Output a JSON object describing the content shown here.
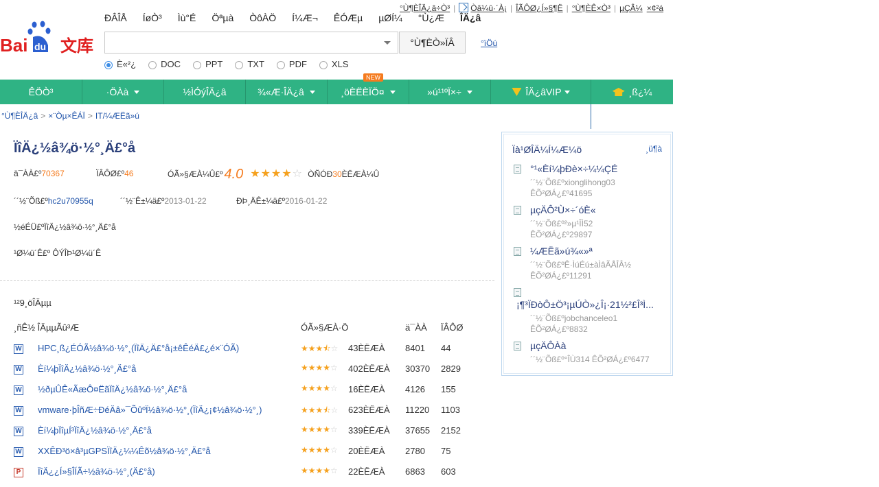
{
  "toplinks": [
    "°Ù¶ÈÎÄ¿â÷Ò³",
    "Òâ¼û·´À¡",
    "ÎÃÔØ¿Í»§¶Ë",
    "°Ù¶ÈÊ×Ò³",
    "µÇÂ¼",
    "×¢²á"
  ],
  "logo": {
    "text_a": "Bai",
    "text_b": "du",
    "text_c": "文库"
  },
  "topnav": [
    "ÐÂÎÅ",
    "ÍøÒ³",
    "Ìù°É",
    "Öªµà",
    "ÒôÀÖ",
    "Í¼Æ¬",
    "ÊÓÆµ",
    "µØÍ¼",
    "°Ù¿Æ",
    "ÎÄ¿â"
  ],
  "search": {
    "value": "",
    "button": "°Ù¶ÈÒ»ÏÂ",
    "help": "°ïÖú"
  },
  "filetypes": [
    {
      "label": "È«²¿",
      "checked": true
    },
    {
      "label": "DOC",
      "checked": false
    },
    {
      "label": "PPT",
      "checked": false
    },
    {
      "label": "TXT",
      "checked": false
    },
    {
      "label": "PDF",
      "checked": false
    },
    {
      "label": "XLS",
      "checked": false
    }
  ],
  "mainnav": {
    "items": [
      "ÊÖÒ³",
      "·ÖÀà",
      "½ÌÓýÎÄ¿â",
      "¾«Æ·ÎÄ¿â",
      "¸öÈËÈÏÖ¤",
      "»ú¹¹ºÏ×÷",
      "ÎÄ¿âVIP",
      "¸ß¿¼"
    ],
    "new_badge": "NEW"
  },
  "breadcrumb": [
    "°Ù¶ÈÎÄ¿â",
    "×¨Òµ×ÊÁÏ",
    "IT/¼ÆËã»ú"
  ],
  "doc": {
    "title": "ÏîÄ¿½â¾ö·½°¸Ä£°å",
    "views_label": "ä¯ÀÀ£º",
    "views": "70367",
    "downloads_label": "ÏÂÔØ£º",
    "downloads": "46",
    "rating_label": "ÓÃ»§ÆÀ¼Û£º",
    "score": "4.0",
    "stars": 4,
    "reviews_prefix": "ÒÑÓÐ",
    "reviews": "30",
    "reviews_suffix": "ÈËÆÀ¼Û",
    "uploader_label": "´´½¨Õß£º",
    "uploader": "hc2u70955q",
    "created_label": "´´½¨Ê±¼ä£º",
    "created": "2013-01-22",
    "updated_label": "ÐÞ¸ÄÊ±¼ä£º",
    "updated": "2016-01-22",
    "desc": "½éÉÜ£ºÏîÄ¿½â¾ö·½°¸Ä£°å",
    "tags": "¹Ø¼ü´Ê£º ÔÝÎÞ¹Ø¼ü´Ê"
  },
  "listing": {
    "total": "¹²9¸öÎÄµµ",
    "headers": [
      "¸ñÊ½ ÎÄµµÃû³Æ",
      "ÓÃ»§ÆÀ·Ö",
      "ä¯ÀÀ",
      "ÏÂÔØ"
    ],
    "rows": [
      {
        "type": "W",
        "title": "HPC¸ß¿ÉÓÃ½â¾ö·½°¸(ÏîÄ¿Ä£°å¡±êÊéÄ£¿é×¨ÓÃ)",
        "stars": 3.5,
        "count": "43ÈËÆÀ",
        "views": "8401",
        "downloads": "44"
      },
      {
        "type": "W",
        "title": "Èí¼þÏîÄ¿½â¾ö·½°¸Ä£°å",
        "stars": 4,
        "count": "402ÈËÆÀ",
        "views": "30370",
        "downloads": "2829"
      },
      {
        "type": "W",
        "title": "½ðµÛÊ«ÃæÔ¤ËãÏîÄ¿½â¾ö·½°¸Ä£°å",
        "stars": 4,
        "count": "16ÈËÆÀ",
        "views": "4126",
        "downloads": "155"
      },
      {
        "type": "W",
        "title": "vmware·þÎñÆ÷ÐéÄâ»¯ÕûºÏ½â¾ö·½°¸(ÏîÄ¿¡¢½â¾ö·½°¸)",
        "stars": 3.5,
        "count": "623ÈËÆÀ",
        "views": "11220",
        "downloads": "1103"
      },
      {
        "type": "W",
        "title": "Èí¼þÏîµÍ³ÏîÄ¿½â¾ö·½°¸Ä£°å",
        "stars": 4,
        "count": "339ÈËÆÀ",
        "views": "37655",
        "downloads": "2152"
      },
      {
        "type": "W",
        "title": "XXÊÐ³ö×â³µGPSÏîÄ¿¼¼Êõ½â¾ö·½°¸Ä£°å",
        "stars": 4,
        "count": "20ÈËÆÀ",
        "views": "2780",
        "downloads": "75"
      },
      {
        "type": "P",
        "title": "ÏîÄ¿¿Í»§ÎÍÃ÷½â¾ö·½°¸(Ä£°å)",
        "stars": 4,
        "count": "22ÈËÆÀ",
        "views": "6863",
        "downloads": "603"
      }
    ]
  },
  "sidebar": {
    "title": "Ïà¹ØÎÄ¼Í¼Æ¼ö",
    "more": "¸ü¶à",
    "items": [
      {
        "title": "°¹«Èí¼þÐè×÷¼¼ÇÉ",
        "author": "´´½¨Õß£ºxionglihong03",
        "downloads": "ÊÕ²ØÁ¿£º41695"
      },
      {
        "title": "µçÄÔ²Ù×÷´óÈ«",
        "author": "´´½¨Õß£º²»µ¹ÎÌ52",
        "downloads": "ÊÕ²ØÁ¿£º29897"
      },
      {
        "title": "¼ÆËã»ú¾«»ª",
        "author": "´´½¨Õß£ºÊ·ÌúÉú±àÌâÃÅÎÂ½",
        "downloads": "ÊÕ²ØÁ¿£º11291"
      },
      {
        "title": "¡¶³ÏÐòÔ±Ö³¡µÚÒ»¿Î¡·21½²£Î³Ì...",
        "author": "´´½¨Õß£ºjobchanceleo1",
        "downloads": "ÊÕ²ØÁ¿£º8832"
      },
      {
        "title": "µçÄÔÀà",
        "author": "´´½¨Õß£º°ÎÙ314  ÊÕ²ØÁ¿£º6477",
        "downloads": ""
      }
    ]
  },
  "colors": {
    "green": "#2fb384",
    "link": "#2255aa",
    "orange": "#f57b1e"
  }
}
